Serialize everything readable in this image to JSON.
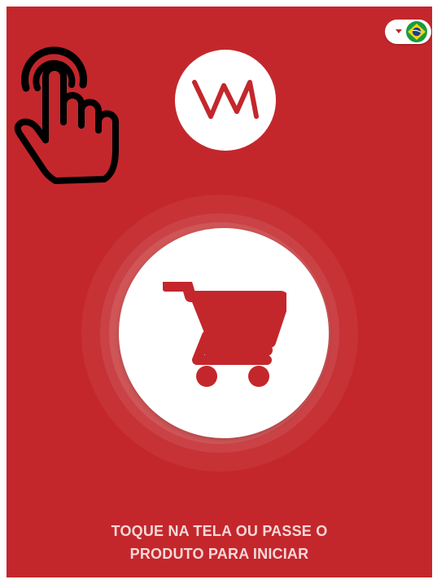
{
  "app": {
    "logo_text": "VM",
    "background_color": "#c3272c"
  },
  "language_selector": {
    "selected_flag": "brazil-flag-icon",
    "dropdown_icon": "caret-down-icon"
  },
  "gesture_hint": {
    "icon": "tap-hand-icon"
  },
  "start_button": {
    "icon": "shopping-cart-icon"
  },
  "instruction": {
    "line1": "TOQUE NA TELA OU PASSE O",
    "line2": "PRODUTO PARA INICIAR"
  }
}
